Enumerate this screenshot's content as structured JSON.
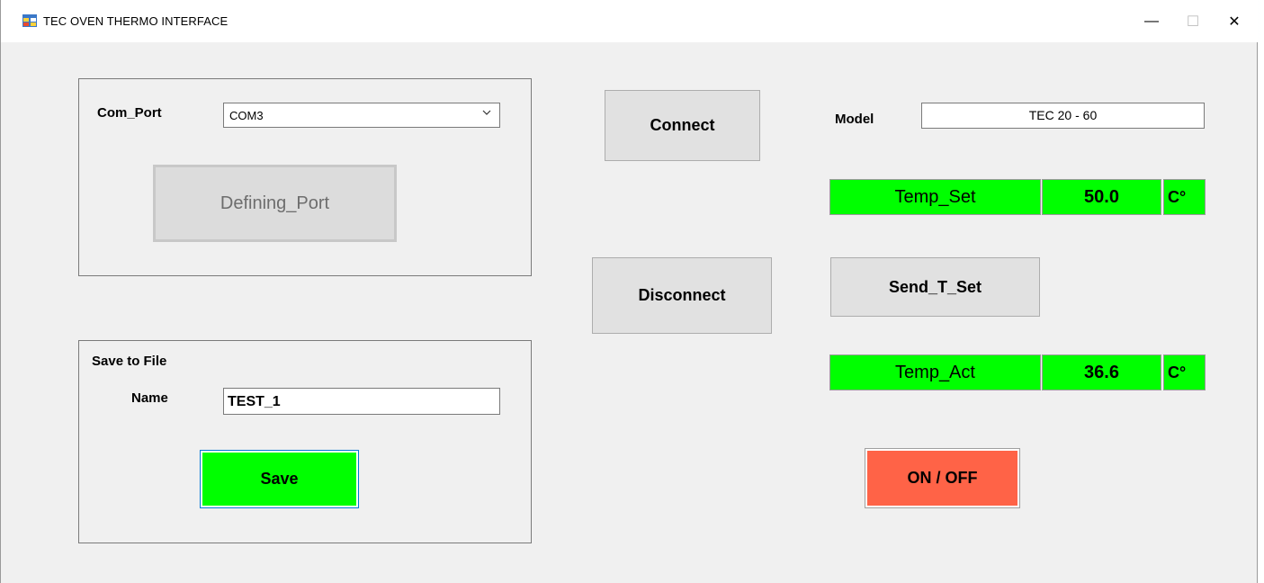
{
  "window": {
    "title": "TEC OVEN THERMO INTERFACE",
    "icon": "app-form-icon",
    "controls": {
      "minimize": "—",
      "maximize": "☐",
      "close": "✕"
    }
  },
  "com_group": {
    "com_port_label": "Com_Port",
    "com_port_value": "COM3",
    "defining_port_button": "Defining_Port"
  },
  "save_group": {
    "title": "Save to File",
    "name_label": "Name",
    "name_value": "TEST_1",
    "save_button": "Save"
  },
  "connection": {
    "connect_button": "Connect",
    "disconnect_button": "Disconnect"
  },
  "device": {
    "model_label": "Model",
    "model_value": "TEC 20 - 60",
    "temp_set_label": "Temp_Set",
    "temp_set_value": "50.0",
    "temp_set_unit": "C°",
    "send_button": "Send_T_Set",
    "temp_act_label": "Temp_Act",
    "temp_act_value": "36.6",
    "temp_act_unit": "C°",
    "onoff_button": "ON / OFF"
  },
  "colors": {
    "indicator_green": "#00ff00",
    "onoff_red": "#ff6347",
    "focus_blue": "#0078d7"
  }
}
